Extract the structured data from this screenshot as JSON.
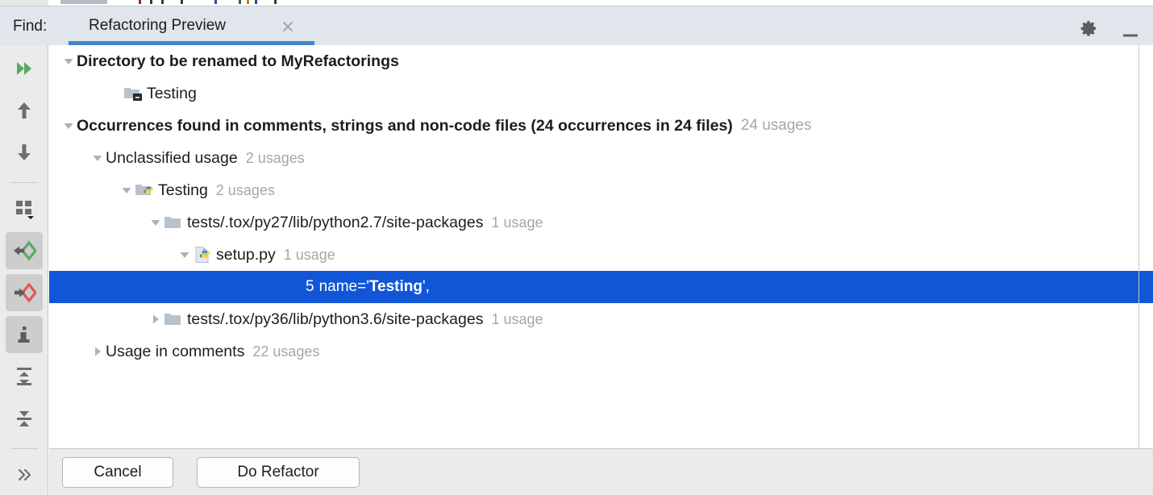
{
  "header": {
    "find_label": "Find:",
    "tab_label": "Refactoring Preview",
    "close_icon": "close-icon",
    "gear_icon": "gear-icon",
    "minimize_icon": "minimize-icon"
  },
  "left_toolbar": {
    "items": [
      {
        "name": "rerun-icon",
        "label": "Rerun",
        "active": false
      },
      {
        "name": "previous-occurrence-icon",
        "label": "Previous Occurrence",
        "active": false
      },
      {
        "name": "next-occurrence-icon",
        "label": "Next Occurrence",
        "active": false
      },
      {
        "name": "group-by-icon",
        "label": "Group By",
        "active": false
      },
      {
        "name": "preview-previous-icon",
        "label": "Preview Previous",
        "active": true
      },
      {
        "name": "preview-next-icon",
        "label": "Preview Next",
        "active": true
      },
      {
        "name": "info-icon",
        "label": "Info",
        "active": true
      },
      {
        "name": "expand-all-icon",
        "label": "Expand All",
        "active": false
      },
      {
        "name": "collapse-all-icon",
        "label": "Collapse All",
        "active": false
      },
      {
        "name": "more-icon",
        "label": "More",
        "active": false
      }
    ]
  },
  "tree": {
    "rows": [
      {
        "id": "directory-to-be-renamed",
        "indent": 14,
        "twisty": "expanded",
        "icon": "none",
        "text": "Directory to be renamed to MyRefactorings",
        "bold": true,
        "count": "",
        "selected": false
      },
      {
        "id": "testing-directory",
        "indent": 72,
        "twisty": "none",
        "icon": "folder-module-icon",
        "text": "Testing",
        "bold": false,
        "count": "",
        "selected": false
      },
      {
        "id": "occurrences-found",
        "indent": 14,
        "twisty": "expanded",
        "icon": "none",
        "text": "Occurrences found in comments, strings and non-code files  (24 occurrences in 24 files)",
        "bold": true,
        "count": "24 usages",
        "selected": false
      },
      {
        "id": "unclassified-usage",
        "indent": 50,
        "twisty": "expanded",
        "icon": "none",
        "text": "Unclassified usage",
        "bold": false,
        "count": "2 usages",
        "selected": false
      },
      {
        "id": "testing-python-package",
        "indent": 86,
        "twisty": "expanded",
        "icon": "folder-python-icon",
        "text": "Testing",
        "bold": false,
        "count": "2 usages",
        "selected": false
      },
      {
        "id": "py27-site-packages",
        "indent": 122,
        "twisty": "expanded",
        "icon": "folder-icon",
        "text": "tests/.tox/py27/lib/python2.7/site-packages",
        "bold": false,
        "count": "1 usage",
        "selected": false
      },
      {
        "id": "setup-py-file",
        "indent": 158,
        "twisty": "expanded",
        "icon": "python-file-icon",
        "text": "setup.py",
        "bold": false,
        "count": "1 usage",
        "selected": false
      },
      {
        "id": "code-occurrence-line",
        "indent": 0,
        "twisty": "none",
        "icon": "none",
        "text": "",
        "bold": false,
        "count": "",
        "selected": true,
        "line_number": "5",
        "code_prefix": "name='",
        "code_match": "Testing",
        "code_suffix": "',",
        "code_indent": 318
      },
      {
        "id": "py36-site-packages",
        "indent": 122,
        "twisty": "collapsed",
        "icon": "folder-icon",
        "text": "tests/.tox/py36/lib/python3.6/site-packages",
        "bold": false,
        "count": "1 usage",
        "selected": false
      },
      {
        "id": "usage-in-comments",
        "indent": 50,
        "twisty": "collapsed",
        "icon": "none",
        "text": "Usage in comments",
        "bold": false,
        "count": "22 usages",
        "selected": false
      }
    ]
  },
  "buttons": {
    "cancel": "Cancel",
    "do_refactor": "Do Refactor"
  },
  "colors": {
    "selection_blue": "#1156d6",
    "tab_underline": "#4186c9",
    "header_bg": "#e1e5ec",
    "toolbar_bg": "#ebebeb",
    "muted_text": "#a6a6a6",
    "accent_green": "#59a869",
    "accent_red": "#e05555"
  }
}
